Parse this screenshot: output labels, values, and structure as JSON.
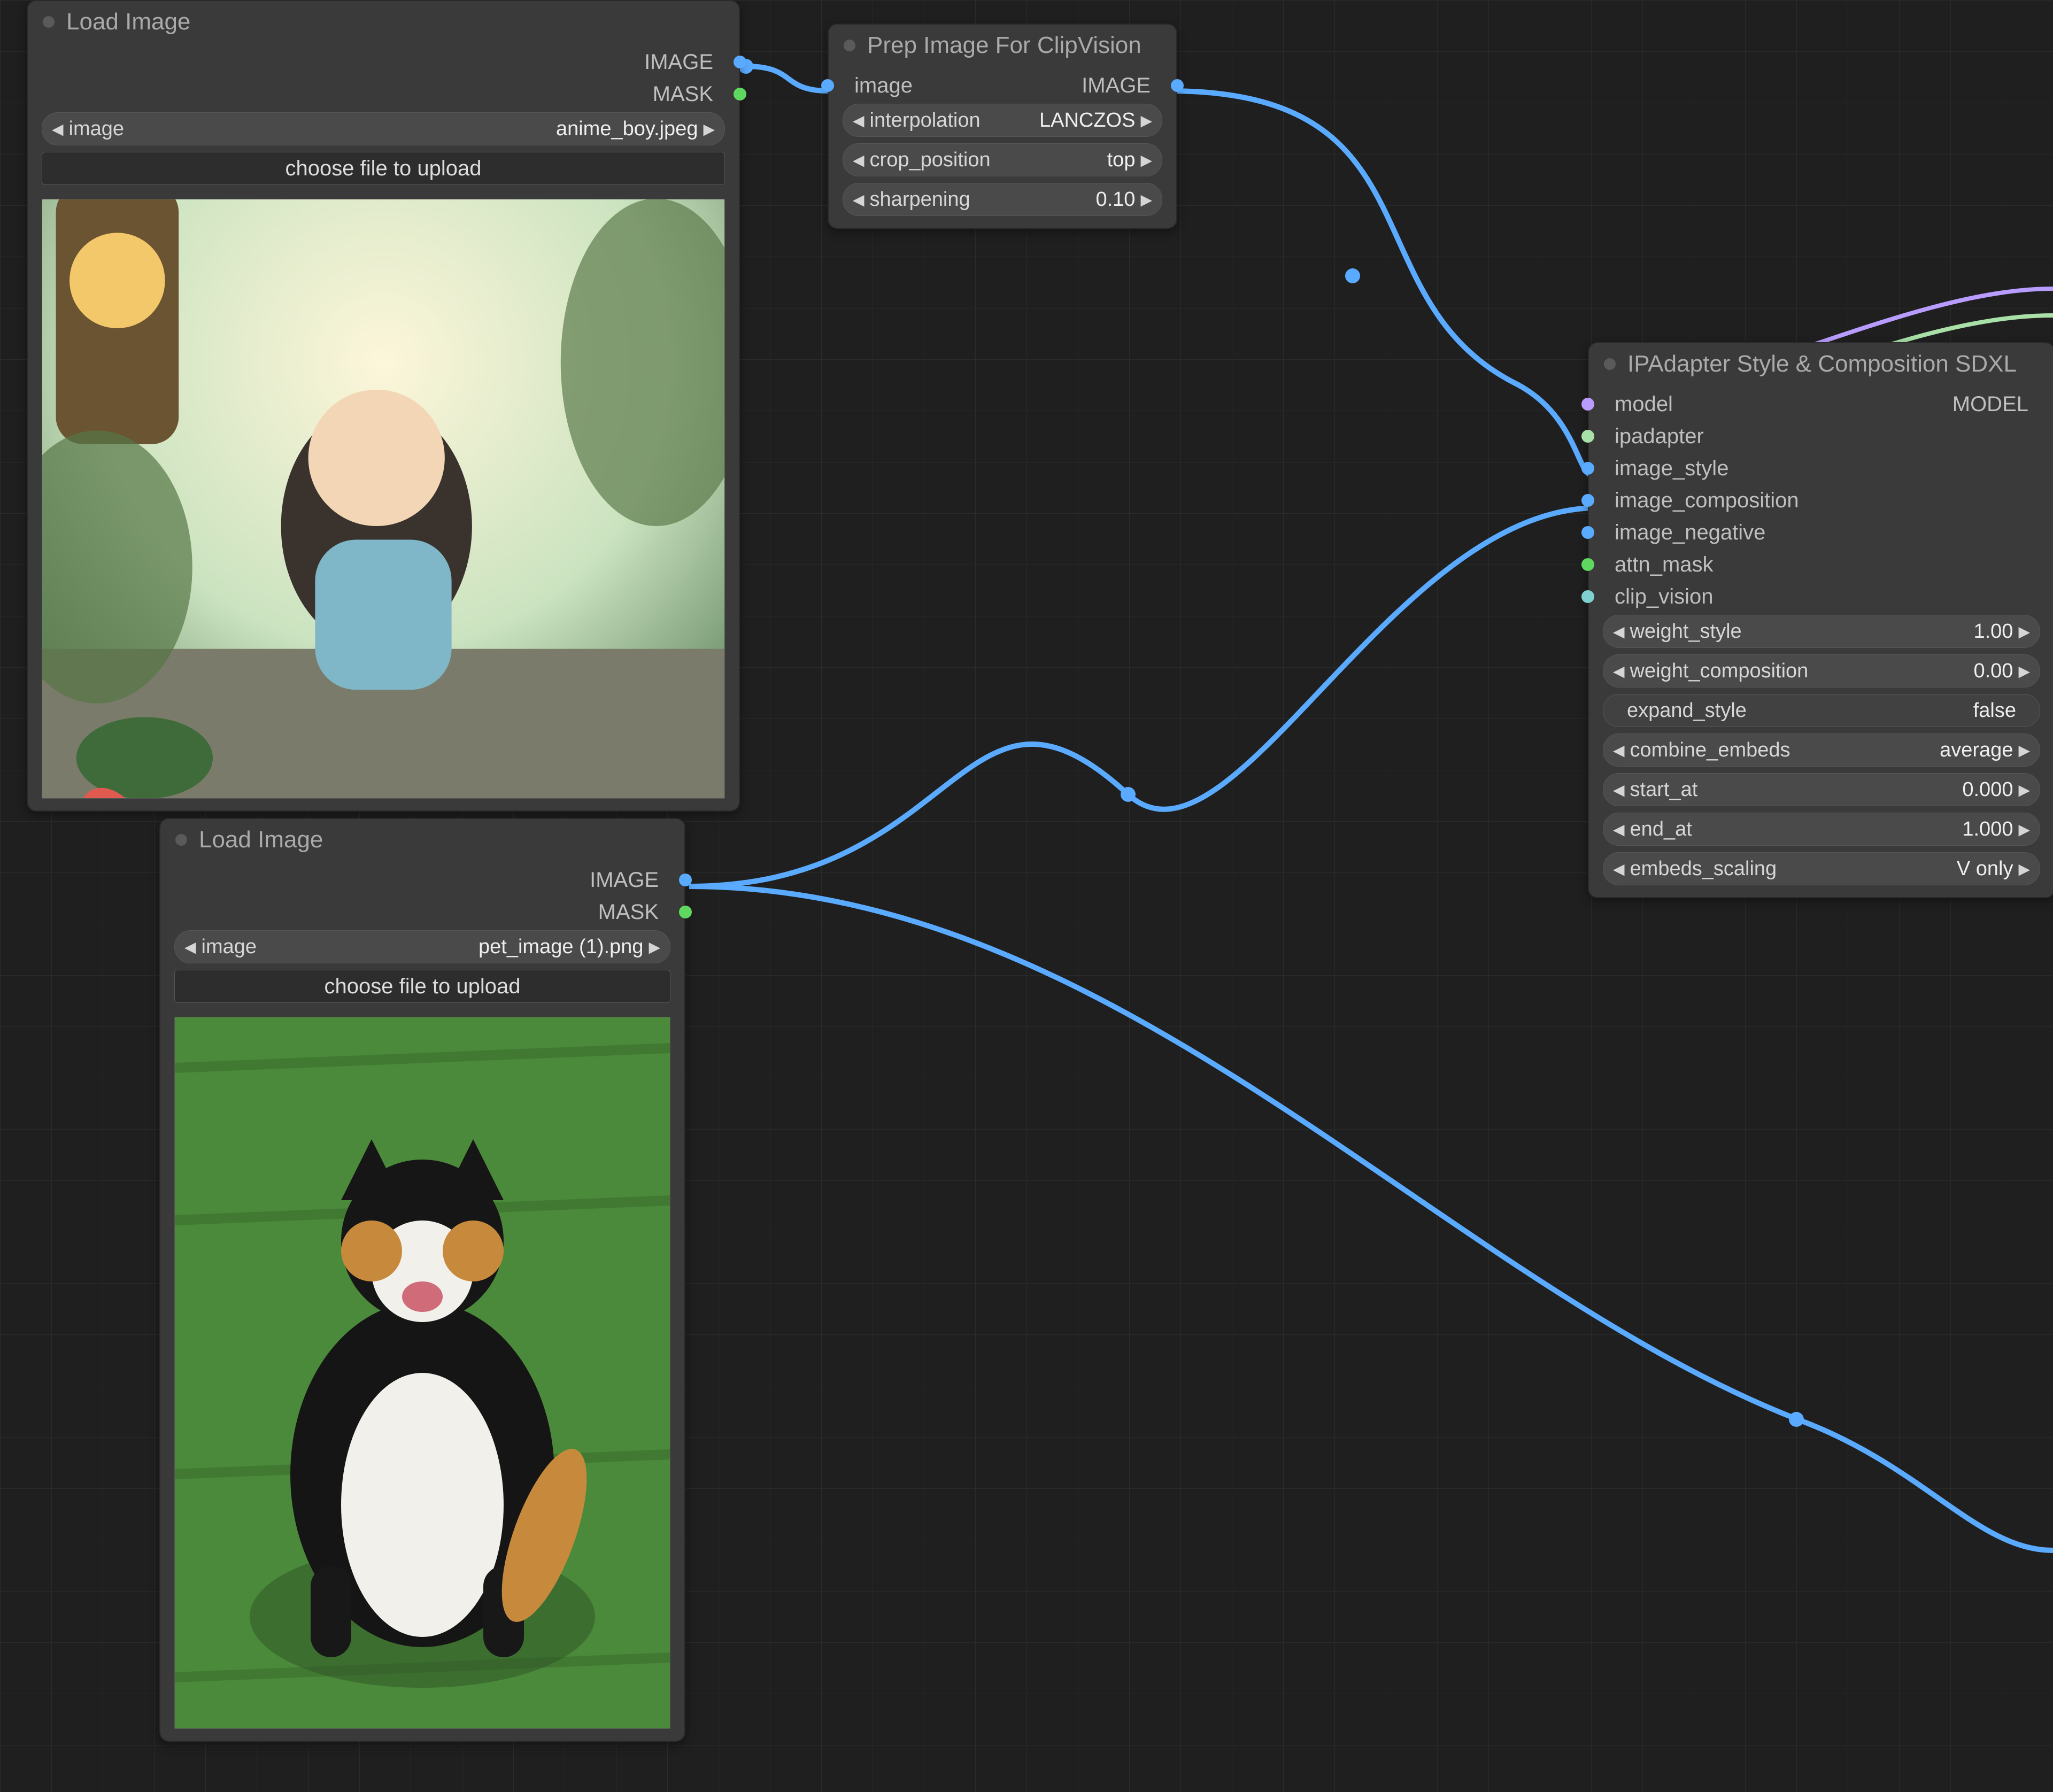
{
  "nodes": {
    "load1": {
      "title": "Load Image",
      "outputs": {
        "image": "IMAGE",
        "mask": "MASK"
      },
      "params": {
        "image_label": "image",
        "image_value": "anime_boy.jpeg",
        "upload": "choose file to upload"
      }
    },
    "load2": {
      "title": "Load Image",
      "outputs": {
        "image": "IMAGE",
        "mask": "MASK"
      },
      "params": {
        "image_label": "image",
        "image_value": "pet_image (1).png",
        "upload": "choose file to upload"
      }
    },
    "prep": {
      "title": "Prep Image For ClipVision",
      "inputs": {
        "image": "image"
      },
      "outputs": {
        "image": "IMAGE"
      },
      "params": {
        "interpolation_label": "interpolation",
        "interpolation_value": "LANCZOS",
        "crop_label": "crop_position",
        "crop_value": "top",
        "sharpening_label": "sharpening",
        "sharpening_value": "0.10"
      }
    },
    "ipa": {
      "title": "IPAdapter Style & Composition SDXL",
      "inputs": {
        "model": "model",
        "ipadapter": "ipadapter",
        "image_style": "image_style",
        "image_composition": "image_composition",
        "image_negative": "image_negative",
        "attn_mask": "attn_mask",
        "clip_vision": "clip_vision"
      },
      "outputs": {
        "model": "MODEL"
      },
      "params": {
        "weight_style_label": "weight_style",
        "weight_style_value": "1.00",
        "weight_composition_label": "weight_composition",
        "weight_composition_value": "0.00",
        "expand_style_label": "expand_style",
        "expand_style_value": "false",
        "combine_embeds_label": "combine_embeds",
        "combine_embeds_value": "average",
        "start_at_label": "start_at",
        "start_at_value": "0.000",
        "end_at_label": "end_at",
        "end_at_value": "1.000",
        "embeds_scaling_label": "embeds_scaling",
        "embeds_scaling_value": "V only"
      }
    }
  }
}
